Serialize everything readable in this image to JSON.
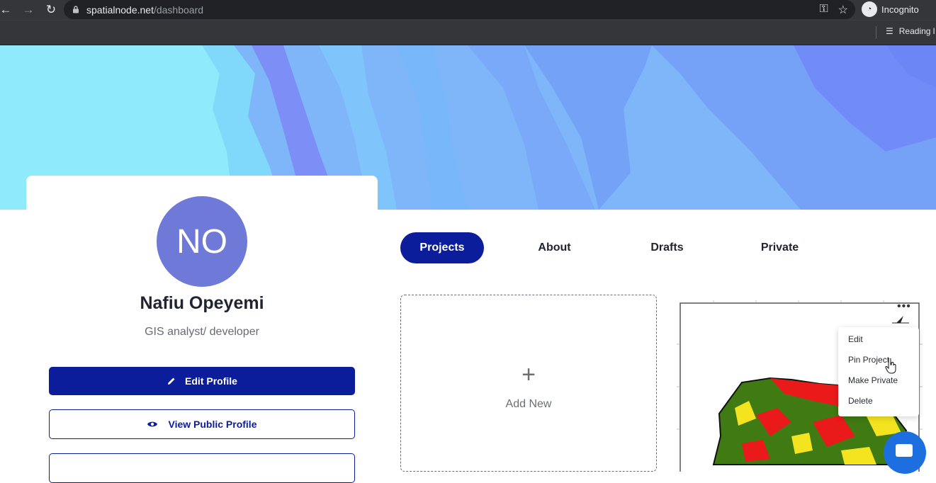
{
  "browser": {
    "url_host": "spatialnode.net",
    "url_path": "/dashboard",
    "incognito_label": "Incognito",
    "reading_label": "Reading l"
  },
  "profile": {
    "initials": "NO",
    "name": "Nafiu Opeyemi",
    "role": "GIS analyst/ developer",
    "edit_label": "Edit Profile",
    "view_label": "View Public Profile",
    "avatar_color": "#6e79d8"
  },
  "tabs": [
    {
      "label": "Projects",
      "active": true
    },
    {
      "label": "About",
      "active": false
    },
    {
      "label": "Drafts",
      "active": false
    },
    {
      "label": "Private",
      "active": false
    }
  ],
  "add_new": {
    "icon": "+",
    "label": "Add New"
  },
  "project_menu": {
    "items": [
      "Edit",
      "Pin Project",
      "Make Private",
      "Delete"
    ]
  },
  "colors": {
    "brand": "#0b1d9b",
    "chrome_bg": "#202124"
  }
}
